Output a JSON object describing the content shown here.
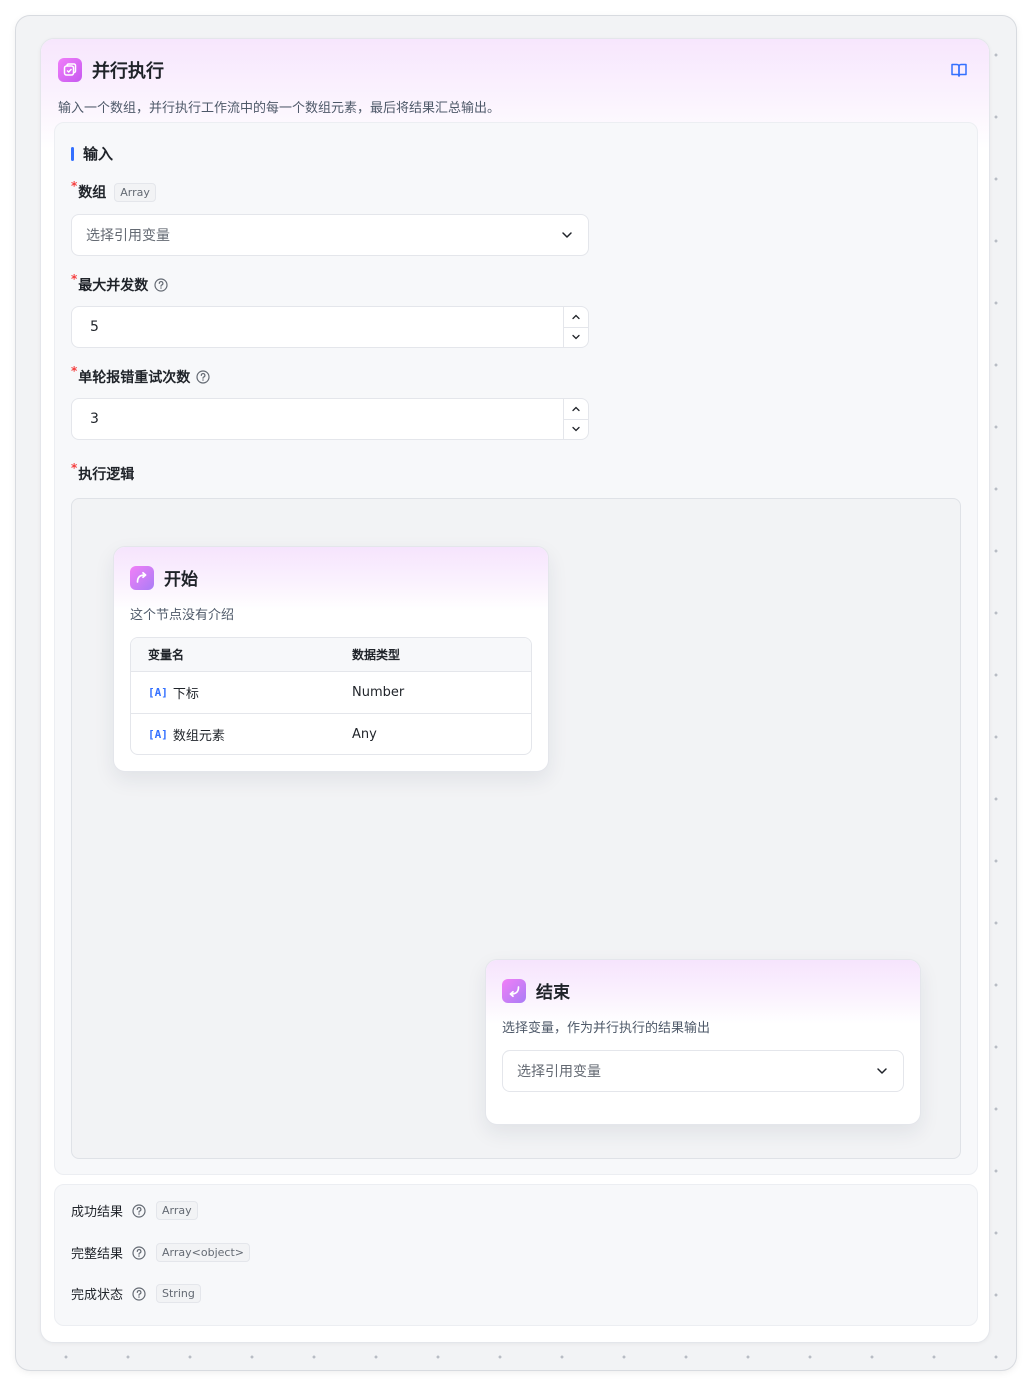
{
  "node": {
    "title": "并行执行",
    "icon": "parallel-node-icon",
    "description": "输入一个数组，并行执行工作流中的每一个数组元素，最后将结果汇总输出。"
  },
  "input_section": {
    "title": "输入",
    "array_field": {
      "label": "数组",
      "type_tag": "Array",
      "placeholder": "选择引用变量"
    },
    "max_concurrency": {
      "label": "最大并发数",
      "value": "5"
    },
    "retry_count": {
      "label": "单轮报错重试次数",
      "value": "3"
    },
    "logic": {
      "label": "执行逻辑"
    },
    "required_mark": "*"
  },
  "start_node": {
    "title": "开始",
    "description": "这个节点没有介绍",
    "columns": [
      "变量名",
      "数据类型"
    ],
    "rows": [
      {
        "tag": "[A]",
        "name": "下标",
        "type": "Number"
      },
      {
        "tag": "[A]",
        "name": "数组元素",
        "type": "Any"
      }
    ]
  },
  "end_node": {
    "title": "结束",
    "description": "选择变量，作为并行执行的结果输出",
    "placeholder": "选择引用变量"
  },
  "outputs": [
    {
      "label": "成功结果",
      "type": "Array"
    },
    {
      "label": "完整结果",
      "type": "Array<object>"
    },
    {
      "label": "完成状态",
      "type": "String"
    }
  ],
  "colors": {
    "accent": "#3370ff",
    "required": "#f53f3f",
    "node_gradient": "#f07ef9"
  }
}
